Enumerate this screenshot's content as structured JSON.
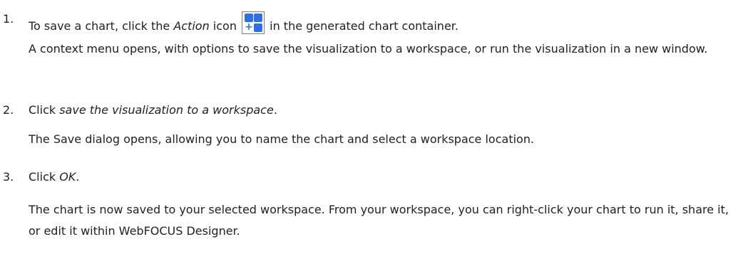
{
  "steps": [
    {
      "number": "1.",
      "instruction_pre": "To save a chart, click the ",
      "instruction_em": "Action",
      "instruction_mid": " icon ",
      "instruction_post": " in the generated chart container.",
      "icon": "action-grid-plus-icon",
      "result": "A context menu opens, with options to save the visualization to a workspace, or run the visualization in a new window."
    },
    {
      "number": "2.",
      "instruction_pre": "Click ",
      "instruction_em": "save the visualization to a workspace",
      "instruction_post": ".",
      "result": "The Save dialog opens, allowing you to name the chart and select a workspace location."
    },
    {
      "number": "3.",
      "instruction_pre": "Click ",
      "instruction_em": "OK",
      "instruction_post": ".",
      "result": "The chart is now saved to your selected workspace. From your workspace, you can right-click your chart to run it, share it, or edit it within WebFOCUS Designer."
    }
  ],
  "colors": {
    "text": "#222222",
    "icon_blue": "#2f6fe0",
    "icon_border": "#7a7a7a"
  }
}
